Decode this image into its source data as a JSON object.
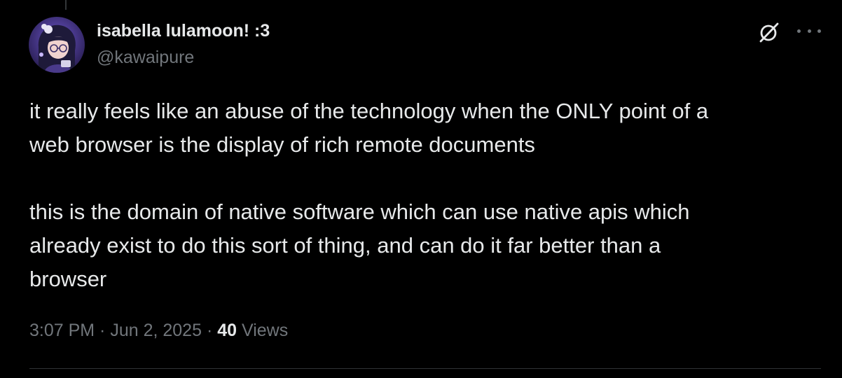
{
  "author": {
    "display_name": "isabella lulamoon! :3",
    "handle": "@kawaipure"
  },
  "header_icons": {
    "grok": "grok-icon",
    "more": "more-icon"
  },
  "tweet": {
    "paragraphs": [
      "it really feels like an abuse of the technology when the ONLY point of a\nweb browser is the display of rich remote documents",
      "this is the domain of native software which can use native apis which\nalready exist to do this sort of thing, and can do it far better than a\nbrowser"
    ]
  },
  "meta": {
    "time": "3:07 PM",
    "separator": " · ",
    "date": "Jun 2, 2025",
    "views_count": "40",
    "views_label": " Views"
  },
  "colors": {
    "background": "#000000",
    "text_primary": "#e7e9ea",
    "text_secondary": "#71767b",
    "divider": "#2f3336"
  }
}
